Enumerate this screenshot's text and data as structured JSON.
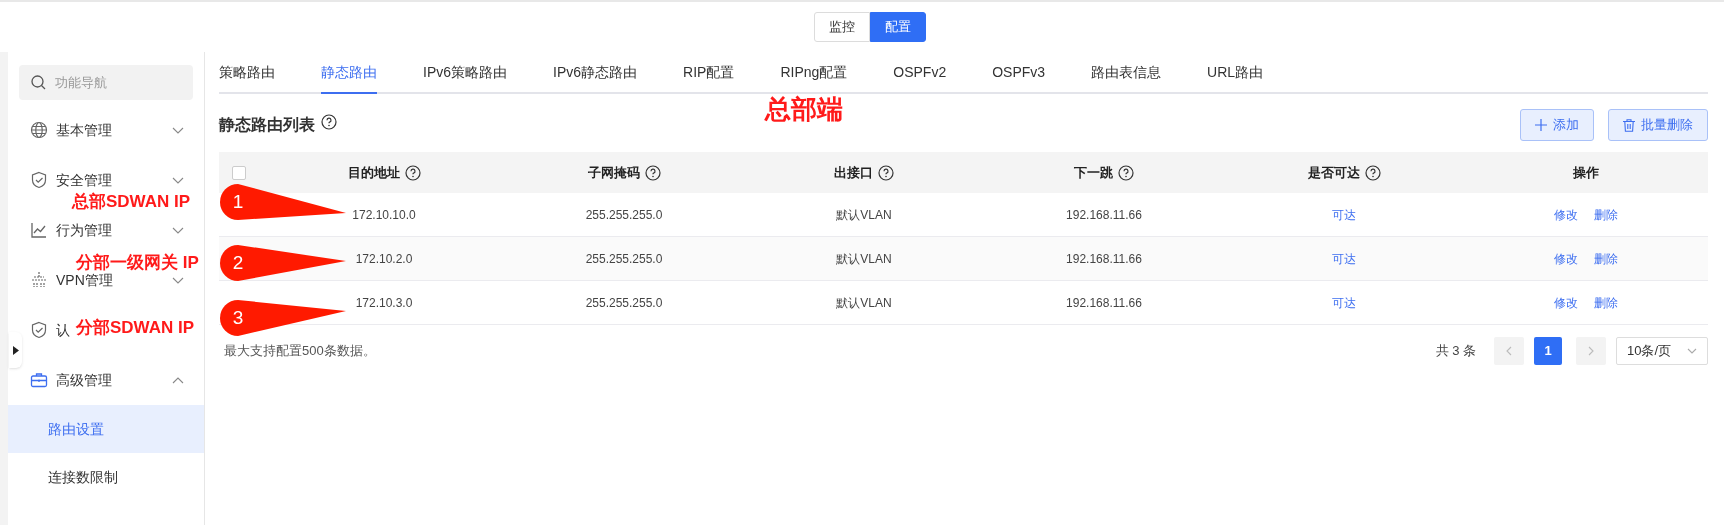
{
  "mode_switch": [
    {
      "label": "监控",
      "selected": false
    },
    {
      "label": "配置",
      "selected": true
    }
  ],
  "sidebar": {
    "search": {
      "placeholder": "功能导航"
    },
    "items": [
      {
        "label": "基本管理",
        "expanded": false
      },
      {
        "label": "安全管理",
        "expanded": false
      },
      {
        "label": "行为管理",
        "expanded": false
      },
      {
        "label": "VPN管理",
        "expanded": false
      },
      {
        "label": "认"
      },
      {
        "label": "高级管理",
        "expanded": true,
        "children": [
          {
            "label": "路由设置",
            "selected": true
          },
          {
            "label": "连接数限制",
            "selected": false
          }
        ]
      }
    ]
  },
  "tabs": [
    {
      "label": "策略路由",
      "selected": false
    },
    {
      "label": "静态路由",
      "selected": true
    },
    {
      "label": "IPv6策略路由",
      "selected": false
    },
    {
      "label": "IPv6静态路由",
      "selected": false
    },
    {
      "label": "RIP配置",
      "selected": false
    },
    {
      "label": "RIPng配置",
      "selected": false
    },
    {
      "label": "OSPFv2",
      "selected": false
    },
    {
      "label": "OSPFv3",
      "selected": false
    },
    {
      "label": "路由表信息",
      "selected": false
    },
    {
      "label": "URL路由",
      "selected": false
    }
  ],
  "header_note": "总部端",
  "panel": {
    "title": "静态路由列表",
    "buttons": [
      {
        "kind": "add",
        "label": "添加"
      },
      {
        "kind": "delete",
        "label": "批量删除"
      }
    ]
  },
  "table": {
    "select_all": {
      "checked": false
    },
    "columns": [
      {
        "label": "目的地址",
        "help": true
      },
      {
        "label": "子网掩码",
        "help": true
      },
      {
        "label": "出接口",
        "help": true
      },
      {
        "label": "下一跳",
        "help": true
      },
      {
        "label": "是否可达",
        "help": true
      },
      {
        "label": "操作",
        "help": false
      }
    ],
    "rows": [
      {
        "destination": "172.10.10.0",
        "mask": "255.255.255.0",
        "interface": "默认VLAN",
        "next_hop": "192.168.11.66",
        "reachable": "可达",
        "actions": [
          "修改",
          "删除"
        ]
      },
      {
        "destination": "172.10.2.0",
        "mask": "255.255.255.0",
        "interface": "默认VLAN",
        "next_hop": "192.168.11.66",
        "reachable": "可达",
        "actions": [
          "修改",
          "删除"
        ]
      },
      {
        "destination": "172.10.3.0",
        "mask": "255.255.255.0",
        "interface": "默认VLAN",
        "next_hop": "192.168.11.66",
        "reachable": "可达",
        "actions": [
          "修改",
          "删除"
        ]
      }
    ]
  },
  "footer_note": "最大支持配置500条数据。",
  "pagination": {
    "total": "共 3 条",
    "pages": [
      {
        "label": "1",
        "selected": true
      }
    ],
    "page_size": "10条/页"
  },
  "annotations": [
    {
      "number": "1",
      "label": "总部SDWAN IP"
    },
    {
      "number": "2",
      "label": "分部一级网关 IP"
    },
    {
      "number": "3",
      "label": "分部SDWAN IP"
    }
  ]
}
